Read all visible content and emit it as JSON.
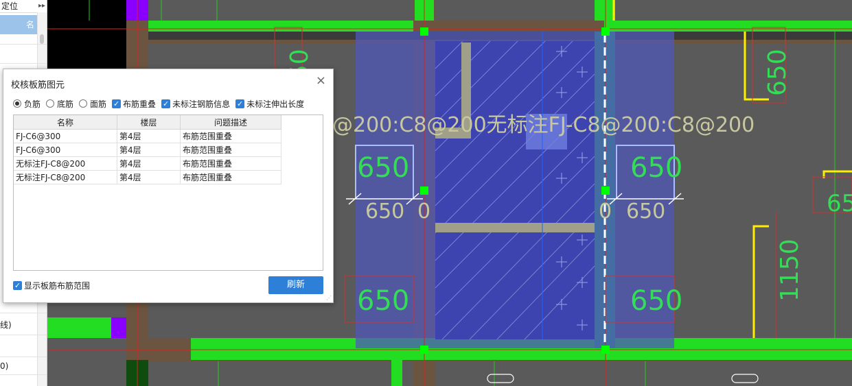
{
  "left_panel": {
    "header": "定位",
    "header_toggle": "▸▸",
    "selected_item": "名",
    "fragments": [
      "线)",
      "0)"
    ]
  },
  "dialog": {
    "title": "校核板筋图元",
    "close_glyph": "×",
    "radio_options": [
      {
        "label": "负筋",
        "checked": true
      },
      {
        "label": "底筋",
        "checked": false
      },
      {
        "label": "面筋",
        "checked": false
      }
    ],
    "check_options": [
      {
        "label": "布筋重叠",
        "checked": true
      },
      {
        "label": "未标注钢筋信息",
        "checked": true
      },
      {
        "label": "未标注伸出长度",
        "checked": true
      }
    ],
    "table": {
      "columns": [
        "名称",
        "楼层",
        "问题描述"
      ],
      "rows": [
        [
          "FJ-C6@300",
          "第4层",
          "布筋范围重叠"
        ],
        [
          "FJ-C6@300",
          "第4层",
          "布筋范围重叠"
        ],
        [
          "无标注FJ-C8@200",
          "第4层",
          "布筋范围重叠"
        ],
        [
          "无标注FJ-C8@200",
          "第4层",
          "布筋范围重叠"
        ]
      ]
    },
    "show_range_label": "显示板筋布筋范围",
    "show_range_checked": true,
    "refresh_label": "刷新",
    "check_glyph": "✓"
  },
  "cad": {
    "rebar_label": "@200:C8@200无标注FJ-C8@200:C8@200",
    "dims": {
      "d650_a": "650",
      "d650_b": "650",
      "d650_c": "650",
      "d650_d": "650",
      "d650_e": "650",
      "d650_f": "650",
      "d650_g": "650",
      "d650_right_vertical": "650",
      "d1150": "1150",
      "d0_left": "0",
      "d0_right": "0",
      "d65_edge": "65"
    }
  }
}
